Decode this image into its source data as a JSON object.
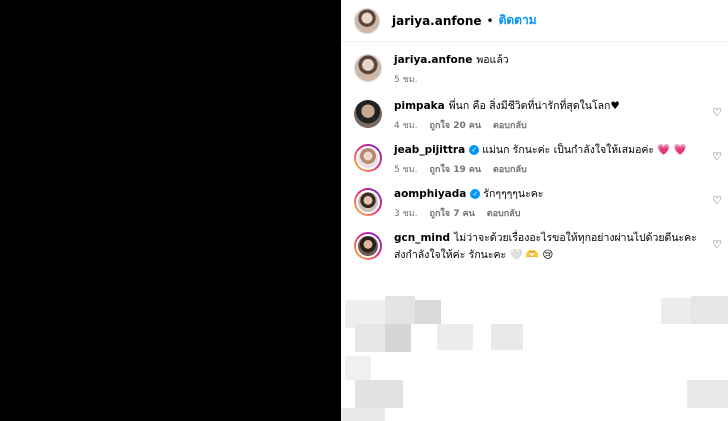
{
  "header": {
    "username": "jariya.anfone",
    "separator": "•",
    "follow_label": "ติดตาม"
  },
  "caption": {
    "username": "jariya.anfone",
    "text": "พอแล้ว",
    "time": "5 ชม."
  },
  "comments": [
    {
      "username": "pimpaka",
      "text": "พี่นก คือ สิ่งมีชีวิตที่น่ารักที่สุดในโลก♥",
      "verified": false,
      "time": "4 ชม.",
      "likes": "ถูกใจ 20 คน",
      "reply": "ตอบกลับ"
    },
    {
      "username": "jeab_pijittra",
      "text": "แม่นก รักนะค่ะ เป็นกำลังใจให้เสมอค่ะ",
      "emoji": "💗 💗",
      "verified": true,
      "time": "5 ชม.",
      "likes": "ถูกใจ 19 คน",
      "reply": "ตอบกลับ"
    },
    {
      "username": "aomphiyada",
      "text": "รักๆๆๆๆนะคะ",
      "verified": true,
      "time": "3 ชม.",
      "likes": "ถูกใจ 7 คน",
      "reply": "ตอบกลับ"
    },
    {
      "username": "gcn_mind",
      "text": "ไม่ว่าจะด้วยเรื่องอะไรขอให้ทุกอย่างผ่านไปด้วยดีนะคะ ส่งกำลังใจให้ค่ะ รักนะคะ",
      "emoji": "🤍 🫶 😢",
      "verified": false
    }
  ],
  "icons": {
    "like": "heart-outline-icon",
    "verified": "verified-badge-icon"
  },
  "colors": {
    "accent": "#0095f6",
    "secondary_text": "#737373"
  }
}
